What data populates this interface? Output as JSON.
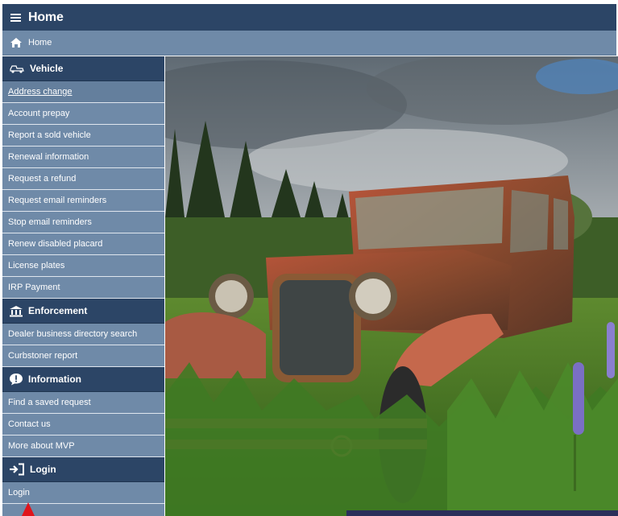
{
  "header": {
    "title": "Home",
    "menu_icon": "hamburger-icon"
  },
  "breadcrumb": {
    "home_label": "Home",
    "icon": "home-icon"
  },
  "sidebar": {
    "vehicle": {
      "heading": "Vehicle",
      "icon": "car-icon",
      "items": [
        {
          "label": "Address change"
        },
        {
          "label": "Account prepay"
        },
        {
          "label": "Report a sold vehicle"
        },
        {
          "label": "Renewal information"
        },
        {
          "label": "Request a refund"
        },
        {
          "label": "Request email reminders"
        },
        {
          "label": "Stop email reminders"
        },
        {
          "label": "Renew disabled placard"
        },
        {
          "label": "License plates"
        },
        {
          "label": "IRP Payment"
        }
      ]
    },
    "enforcement": {
      "heading": "Enforcement",
      "icon": "courthouse-icon",
      "items": [
        {
          "label": "Dealer business directory search"
        },
        {
          "label": "Curbstoner report"
        }
      ]
    },
    "information": {
      "heading": "Information",
      "icon": "info-bubble-icon",
      "items": [
        {
          "label": "Find a saved request"
        },
        {
          "label": "Contact us"
        },
        {
          "label": "More about MVP"
        }
      ]
    },
    "login": {
      "heading": "Login",
      "icon": "sign-in-icon",
      "items": [
        {
          "label": "Login"
        }
      ]
    }
  },
  "hero": {
    "subject": "rusted vintage truck in overgrown field with lupines"
  },
  "colors": {
    "header": "#2c4566",
    "subbar": "#6f8aa8",
    "pointer": "#e0141b"
  }
}
